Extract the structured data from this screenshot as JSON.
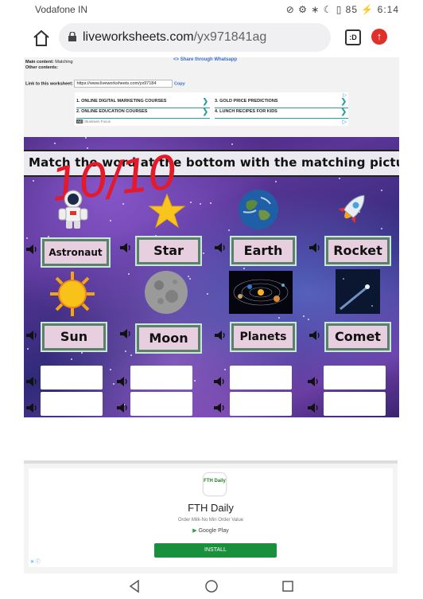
{
  "status_bar": {
    "carrier": "Vodafone IN",
    "battery": "85",
    "time": "6:14"
  },
  "browser": {
    "url_domain": "liveworksheets.com",
    "url_path": "/yx971841ag",
    "tab_count": ":D"
  },
  "worksheet_info": {
    "main_content_label": "Main content:",
    "main_content_value": "Matching",
    "other_contents_label": "Other contents:",
    "share_label": "Share through Whatsapp",
    "link_label": "Link to this worksheet:",
    "link_value": "https://www.liveworksheets.com/yx97184",
    "copy_label": "Copy"
  },
  "top_ad": {
    "items": [
      "1. ONLINE DIGITAL MARKETING COURSES",
      "2. ONLINE EDUCATION COURSES",
      "3. GOLD PRICE PREDICTIONS",
      "4. LUNCH RECIPES FOR KIDS"
    ],
    "footer": "| Business Focus"
  },
  "activity": {
    "instruction": "Match the word at the bottom with the matching picture.",
    "score": "10/10",
    "answers": [
      "Astronaut",
      "Star",
      "Earth",
      "Rocket",
      "Sun",
      "Moon",
      "Planets",
      "Comet"
    ],
    "pictures": [
      "astronaut",
      "star",
      "earth",
      "rocket",
      "sun",
      "moon",
      "planets",
      "comet"
    ]
  },
  "bottom_ad": {
    "logo_text": "FTH Daily",
    "app_name": "FTH Daily",
    "subtitle": "Order Milk-No Min Order Value",
    "store": "Google Play",
    "install_label": "INSTALL"
  },
  "colors": {
    "score_red": "#e4192a",
    "install_green": "#1a8f3c",
    "word_box": "#e8cfe0"
  }
}
